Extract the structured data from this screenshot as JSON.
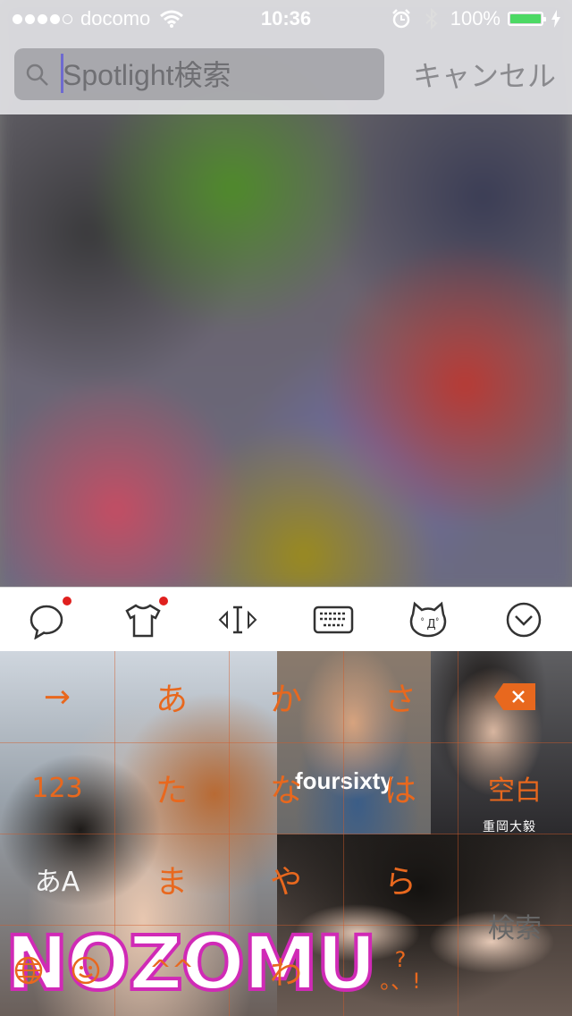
{
  "status_bar": {
    "carrier": "docomo",
    "signal_bars_filled": 4,
    "time": "10:36",
    "battery_percent": "100%"
  },
  "search": {
    "placeholder": "Spotlight検索",
    "cancel_label": "キャンセル"
  },
  "keyboard_toolbar": {
    "icons": [
      "chat-bubble-icon",
      "tshirt-icon",
      "cursor-move-icon",
      "keyboard-icon",
      "cat-face-icon",
      "chevron-down-icon"
    ]
  },
  "keyboard": {
    "rows": [
      [
        "→",
        "あ",
        "か",
        "さ",
        "⌫"
      ],
      [
        "123",
        "た",
        "な",
        "は",
        "空白"
      ],
      [
        "あA",
        "ま",
        "や",
        "ら",
        ""
      ],
      [
        "🌐",
        "☺",
        "^^",
        "わ",
        "?。、!",
        "検索"
      ]
    ],
    "keys": {
      "arrow": "→",
      "a": "あ",
      "ka": "か",
      "sa": "さ",
      "num": "123",
      "ta": "た",
      "na": "な",
      "ha": "は",
      "space": "空白",
      "mode": "あA",
      "ma": "ま",
      "ya": "や",
      "ra": "ら",
      "kaomoji": "^^",
      "wa": "わ",
      "punct_top": "?",
      "punct_bottom": "。、!",
      "search": "検索"
    },
    "theme_text": "NOZOMU",
    "photo_caption": "重岡大毅",
    "shirt_text": "foursixty"
  },
  "colors": {
    "key_text": "#e8681e",
    "status_green": "#4cd964",
    "notification_dot": "#e0201e",
    "logo_outline": "#d02ab6"
  }
}
